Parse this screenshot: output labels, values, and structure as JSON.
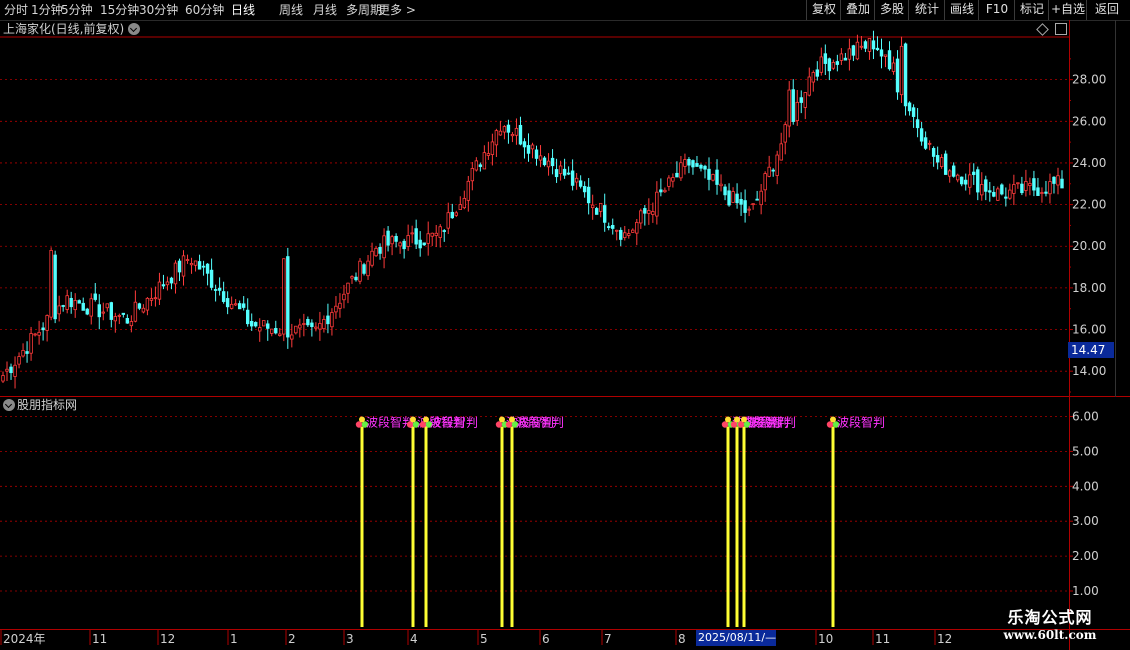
{
  "toolbar": {
    "periods": [
      "分时",
      "1分钟",
      "5分钟",
      "15分钟",
      "30分钟",
      "60分钟",
      "日线",
      "周线",
      "月线",
      "多周期",
      "更多 >"
    ],
    "active": "日线",
    "right_buttons": [
      "复权",
      "叠加",
      "多股",
      "统计",
      "画线",
      "F10",
      "标记",
      "+自选",
      "返回"
    ]
  },
  "main_title": "上海家化(日线,前复权)",
  "indicator_title": "股朋指标网",
  "price_tag": "14.47",
  "date_tag": "2025/08/11/—",
  "watermark": {
    "line1": "乐淘公式网",
    "line2": "www.60lt.com"
  },
  "chart_data": [
    {
      "type": "candlestick",
      "title": "上海家化(日线,前复权)",
      "ylim": [
        13.0,
        30.0
      ],
      "y_ticks": [
        "14.00",
        "16.00",
        "18.00",
        "20.00",
        "22.00",
        "24.00",
        "26.00",
        "28.00"
      ],
      "last_price": 14.47,
      "colors": {
        "up": "#ff3b3b",
        "down": "#54ffff"
      },
      "approx_close_path": [
        {
          "x_label": "2024年",
          "close": 13.8
        },
        {
          "x_label": "2024年",
          "close": 17.5
        },
        {
          "x_label": "11",
          "close": 16.5
        },
        {
          "x_label": "12",
          "close": 19.5
        },
        {
          "x_label": "1",
          "close": 16.2
        },
        {
          "x_label": "2",
          "close": 15.8
        },
        {
          "x_label": "3",
          "close": 20.0
        },
        {
          "x_label": "4",
          "close": 20.5
        },
        {
          "x_label": "5",
          "close": 26.0
        },
        {
          "x_label": "6",
          "close": 23.5
        },
        {
          "x_label": "7",
          "close": 20.5
        },
        {
          "x_label": "7",
          "close": 24.0
        },
        {
          "x_label": "8",
          "close": 21.5
        },
        {
          "x_label": "2025/08/11/—",
          "close": 28.5
        },
        {
          "x_label": "10",
          "close": 29.8
        },
        {
          "x_label": "11",
          "close": 24.0
        },
        {
          "x_label": "12",
          "close": 22.5
        },
        {
          "x_label": "12",
          "close": 23.0
        }
      ]
    },
    {
      "type": "bar",
      "title": "股朋指标网",
      "ylim": [
        0.5,
        6.5
      ],
      "y_ticks": [
        "1.00",
        "2.00",
        "3.00",
        "4.00",
        "5.00",
        "6.00"
      ],
      "signal_label": "波段智判",
      "signals": [
        {
          "month": "3",
          "value": 6.0
        },
        {
          "month": "4",
          "value": 6.0
        },
        {
          "month": "4",
          "value": 6.0
        },
        {
          "month": "5",
          "value": 6.0
        },
        {
          "month": "5",
          "value": 6.0
        },
        {
          "month": "8",
          "value": 6.0
        },
        {
          "month": "8",
          "value": 6.0
        },
        {
          "month": "9",
          "value": 6.0
        },
        {
          "month": "10",
          "value": 6.0
        }
      ]
    }
  ],
  "x_axis": [
    "2024年",
    "11",
    "12",
    "1",
    "2",
    "3",
    "4",
    "5",
    "6",
    "7",
    "8",
    "2025/08/11/—",
    "10",
    "11",
    "12"
  ]
}
